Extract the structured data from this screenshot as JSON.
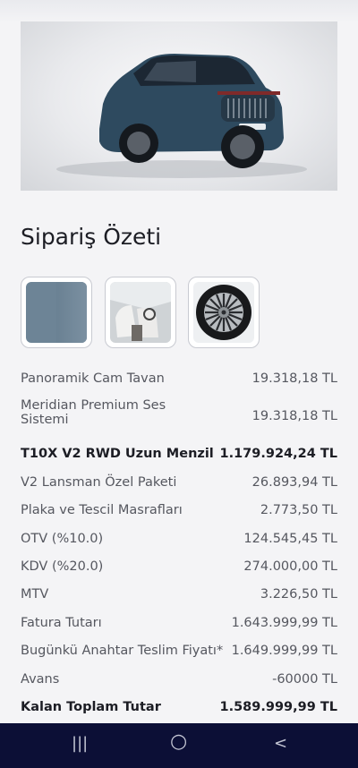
{
  "summary": {
    "title": "Sipariş Özeti"
  },
  "options": {
    "color": "#6d8496",
    "thumbnails": [
      "color-swatch-icon",
      "interior-icon",
      "wheel-icon"
    ]
  },
  "line_items": [
    {
      "label": "Panoramik Cam Tavan",
      "value": "19.318,18 TL"
    },
    {
      "label": "Meridian Premium Ses",
      "label2": "Sistemi",
      "value": "19.318,18 TL"
    },
    {
      "label": "T10X V2 RWD Uzun Menzil",
      "value": "1.179.924,24 TL"
    },
    {
      "label": "V2 Lansman Özel Paketi",
      "value": "26.893,94 TL"
    },
    {
      "label": "Plaka ve Tescil Masrafları",
      "value": "2.773,50 TL"
    },
    {
      "label": "OTV (%10.0)",
      "value": "124.545,45 TL"
    },
    {
      "label": "KDV (%20.0)",
      "value": "274.000,00 TL"
    },
    {
      "label": "MTV",
      "value": "3.226,50 TL"
    },
    {
      "label": "Fatura Tutarı",
      "value": "1.643.999,99 TL"
    },
    {
      "label": "Bugünkü Anahtar Teslim Fiyatı*",
      "value": "1.649.999,99 TL"
    },
    {
      "label": "Avans",
      "value": "-60000 TL"
    },
    {
      "label": "Kalan Toplam Tutar",
      "value": "1.589.999,99 TL"
    }
  ],
  "nav": {
    "recent": "|||",
    "home": "○",
    "back": "<"
  },
  "colors": {
    "nav_bar": "#0c0f36",
    "car_body": "#2e4a5f"
  }
}
